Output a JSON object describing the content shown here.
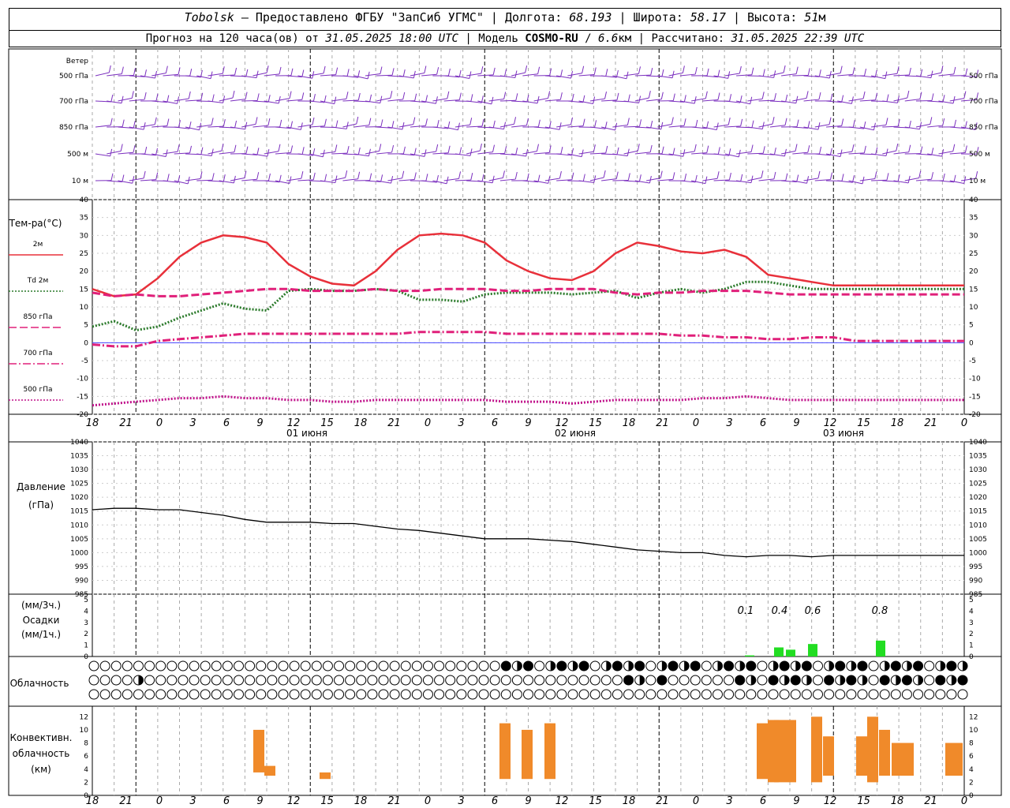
{
  "header": {
    "station": "Tobolsk",
    "dash": "—",
    "provider": "Предоставлено ФГБУ \"ЗапСиб УГМС\"",
    "lon_label": "Долгота:",
    "lon_value": "68.193",
    "lat_label": "Широта:",
    "lat_value": "58.17",
    "alt_label": "Высота:",
    "alt_value": "51",
    "alt_unit": "м",
    "forecast_label": "Прогноз на 120 часа(ов) от",
    "forecast_time": "31.05.2025 18:00 UTC",
    "model_label": "Модель",
    "model_name": "COSMO-RU",
    "model_res": "6.6",
    "model_res_unit": "км",
    "calc_label": "Рассчитано:",
    "calc_time": "31.05.2025 22:39 UTC"
  },
  "wind_panel": {
    "title": "Ветер",
    "levels": [
      "500 гПа",
      "700 гПа",
      "850 гПа",
      "500  м",
      "10  м"
    ],
    "color": "#7b2fbf"
  },
  "temp_panel": {
    "title": "Тем-ра(°C)",
    "legend": [
      {
        "label": "2м",
        "color": "#e8303a",
        "style": "solid"
      },
      {
        "label": "Td  2м",
        "color": "#2a7a2a",
        "style": "dotted"
      },
      {
        "label": "850  гПа",
        "color": "#e0207a",
        "style": "dashed"
      },
      {
        "label": "700  гПа",
        "color": "#e0207a",
        "style": "dashdot"
      },
      {
        "label": "500  гПа",
        "color": "#c0108a",
        "style": "dotted"
      }
    ],
    "y_ticks": [
      "40",
      "35",
      "30",
      "25",
      "20",
      "15",
      "10",
      "5",
      "0",
      "-5",
      "-10",
      "-15",
      "-20"
    ]
  },
  "time_axis": {
    "hour_labels": [
      "18",
      "21",
      "0",
      "3",
      "6",
      "9",
      "12",
      "15",
      "18",
      "21",
      "0",
      "3",
      "6",
      "9",
      "12",
      "15",
      "18",
      "21",
      "0",
      "3",
      "6",
      "9",
      "12",
      "15",
      "18",
      "21",
      "0"
    ],
    "day_labels": [
      "01 июня",
      "02 июня",
      "03 июня"
    ]
  },
  "pressure_panel": {
    "title": "Давление",
    "unit": "(гПа)",
    "y_ticks": [
      "1040",
      "1035",
      "1030",
      "1025",
      "1020",
      "1015",
      "1010",
      "1005",
      "1000",
      "995",
      "990",
      "985"
    ]
  },
  "precip_panel": {
    "unit3": "(мм/3ч.)",
    "title": "Осадки",
    "unit1": "(мм/1ч.)",
    "y_ticks": [
      "5",
      "4",
      "3",
      "2",
      "1",
      "0"
    ],
    "labels": [
      "0.1",
      "0.4",
      "0.6",
      "0.8"
    ],
    "color": "#22dd22"
  },
  "cloud_panel": {
    "title": "Облачность"
  },
  "conv_panel": {
    "title1": "Конвективн.",
    "title2": "облачность",
    "unit": "(км)",
    "y_ticks": [
      "12",
      "10",
      "8",
      "6",
      "4",
      "2",
      "0"
    ],
    "color": "#f08a2a"
  },
  "chart_data": [
    {
      "type": "line",
      "title": "Тем-ра(°C)",
      "x_hours_from_start": [
        0,
        3,
        6,
        9,
        12,
        15,
        18,
        21,
        24,
        27,
        30,
        33,
        36,
        39,
        42,
        45,
        48,
        51,
        54,
        57,
        60,
        63,
        66,
        69,
        72,
        75,
        78,
        81,
        84,
        87,
        90,
        93,
        96,
        99,
        102,
        105,
        108,
        111,
        114,
        117,
        120
      ],
      "ylim": [
        -20,
        40
      ],
      "series": [
        {
          "name": "2м",
          "values": [
            15,
            13,
            13.5,
            18,
            24,
            28,
            30,
            29.5,
            28,
            22,
            18.5,
            16.5,
            16,
            20,
            26,
            30,
            30.5,
            30,
            28,
            23,
            20,
            18,
            17.5,
            20,
            25,
            28,
            27,
            25.5,
            25,
            26,
            24,
            19,
            18,
            17,
            16,
            16,
            16,
            16,
            16,
            16,
            16
          ]
        },
        {
          "name": "Td 2м",
          "values": [
            4.5,
            6,
            3.5,
            4.5,
            7,
            9,
            11,
            9.5,
            9,
            14.5,
            15,
            14.5,
            14.5,
            15,
            14.5,
            12,
            12,
            11.5,
            13.5,
            14,
            14,
            14,
            13.5,
            14,
            14.5,
            12.5,
            14,
            15,
            14,
            15,
            17,
            17,
            16,
            15,
            15,
            15,
            15,
            15,
            15,
            15,
            15
          ]
        },
        {
          "name": "850 гПа",
          "values": [
            14,
            13,
            13.5,
            13,
            13,
            13.5,
            14,
            14.5,
            15,
            15,
            14.5,
            14.5,
            14.5,
            15,
            14.5,
            14.5,
            15,
            15,
            15,
            14.5,
            14.5,
            15,
            15,
            15,
            14,
            13.5,
            14,
            14,
            14.5,
            14.5,
            14.5,
            14,
            13.5,
            13.5,
            13.5,
            13.5,
            13.5,
            13.5,
            13.5,
            13.5,
            13.5
          ]
        },
        {
          "name": "700 гПа",
          "values": [
            -0.5,
            -1,
            -1,
            0.5,
            1,
            1.5,
            2,
            2.5,
            2.5,
            2.5,
            2.5,
            2.5,
            2.5,
            2.5,
            2.5,
            3,
            3,
            3,
            3,
            2.5,
            2.5,
            2.5,
            2.5,
            2.5,
            2.5,
            2.5,
            2.5,
            2,
            2,
            1.5,
            1.5,
            1,
            1,
            1.5,
            1.5,
            0.5,
            0.5,
            0.5,
            0.5,
            0.5,
            0.5
          ]
        },
        {
          "name": "500 гПа",
          "values": [
            -17.5,
            -17,
            -16.5,
            -16,
            -15.5,
            -15.5,
            -15,
            -15.5,
            -15.5,
            -16,
            -16,
            -16.5,
            -16.5,
            -16,
            -16,
            -16,
            -16,
            -16,
            -16,
            -16.5,
            -16.5,
            -16.5,
            -17,
            -16.5,
            -16,
            -16,
            -16,
            -16,
            -15.5,
            -15.5,
            -15,
            -15.5,
            -16,
            -16,
            -16,
            -16,
            -16,
            -16,
            -16,
            -16,
            -16
          ]
        }
      ]
    },
    {
      "type": "line",
      "title": "Давление (гПа)",
      "x_hours_from_start": [
        0,
        3,
        6,
        9,
        12,
        15,
        18,
        21,
        24,
        27,
        30,
        33,
        36,
        39,
        42,
        45,
        48,
        51,
        54,
        57,
        60,
        63,
        66,
        69,
        72,
        75,
        78,
        81,
        84,
        87,
        90,
        93,
        96,
        99,
        102,
        105,
        108,
        111,
        114,
        117,
        120
      ],
      "ylim": [
        985,
        1040
      ],
      "series": [
        {
          "name": "Давление",
          "values": [
            1015.5,
            1016,
            1016,
            1015.5,
            1015.5,
            1014.5,
            1013.5,
            1012,
            1011,
            1011,
            1011,
            1010.5,
            1010.5,
            1009.5,
            1008.5,
            1008,
            1007,
            1006,
            1005,
            1005,
            1005,
            1004.5,
            1004,
            1003,
            1002,
            1001,
            1000.5,
            1000,
            1000,
            999,
            998.5,
            999,
            999,
            998.5,
            999,
            999,
            999,
            999,
            999,
            999,
            999
          ]
        }
      ]
    },
    {
      "type": "bar",
      "title": "Осадки (мм/3ч.)",
      "x_hours_from_start": [
        102,
        105,
        108,
        111,
        114,
        117,
        120,
        123,
        126
      ],
      "values": [
        0.1,
        0.4,
        0.6,
        0,
        0,
        0.8,
        0,
        0,
        0
      ],
      "ylim": [
        0,
        5
      ]
    },
    {
      "type": "bar",
      "title": "Конвективн. облачность (км)",
      "series": [
        {
          "name": "bottom",
          "values": [
            3.5,
            3.5,
            3,
            3,
            2.5,
            2.5,
            2.5,
            2.5,
            2,
            2,
            2,
            3,
            3,
            2,
            3,
            3
          ]
        },
        {
          "name": "top",
          "values": [
            3.5,
            10,
            4.5,
            3,
            11,
            10,
            11,
            11,
            11.5,
            11.5,
            12,
            9,
            9,
            12,
            10,
            8
          ]
        }
      ],
      "x_hours_from_start": [
        26,
        28,
        30,
        32,
        55,
        59,
        63,
        107,
        111,
        115,
        119,
        125,
        127,
        129,
        131,
        135
      ],
      "ylim": [
        0,
        12
      ]
    }
  ]
}
